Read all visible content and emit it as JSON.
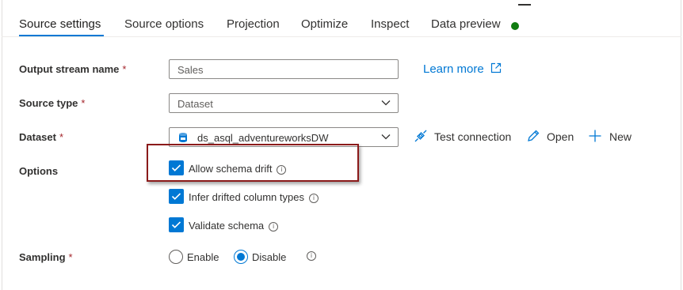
{
  "tabs": [
    {
      "label": "Source settings",
      "active": true
    },
    {
      "label": "Source options",
      "active": false
    },
    {
      "label": "Projection",
      "active": false
    },
    {
      "label": "Optimize",
      "active": false
    },
    {
      "label": "Inspect",
      "active": false
    },
    {
      "label": "Data preview",
      "active": false,
      "status_color": "#107c10"
    }
  ],
  "form": {
    "output_stream": {
      "label": "Output stream name",
      "required_marker": "*",
      "value": "Sales"
    },
    "source_type": {
      "label": "Source type",
      "required_marker": "*",
      "value": "Dataset"
    },
    "dataset": {
      "label": "Dataset",
      "required_marker": "*",
      "value": "ds_asql_adventureworksDW",
      "icon": "sql-database-icon"
    },
    "options": {
      "label": "Options",
      "items": [
        {
          "label": "Allow schema drift",
          "checked": true,
          "highlighted": true
        },
        {
          "label": "Infer drifted column types",
          "checked": true
        },
        {
          "label": "Validate schema",
          "checked": true
        }
      ]
    },
    "sampling": {
      "label": "Sampling",
      "required_marker": "*",
      "options": [
        {
          "label": "Enable",
          "selected": false
        },
        {
          "label": "Disable",
          "selected": true
        }
      ]
    }
  },
  "links": {
    "learn_more": "Learn more"
  },
  "actions": {
    "test_connection": "Test connection",
    "open": "Open",
    "new": "New"
  },
  "colors": {
    "accent": "#0078d4",
    "required": "#a4262c",
    "highlight_border": "#8b1a1a",
    "status_ok": "#107c10"
  }
}
